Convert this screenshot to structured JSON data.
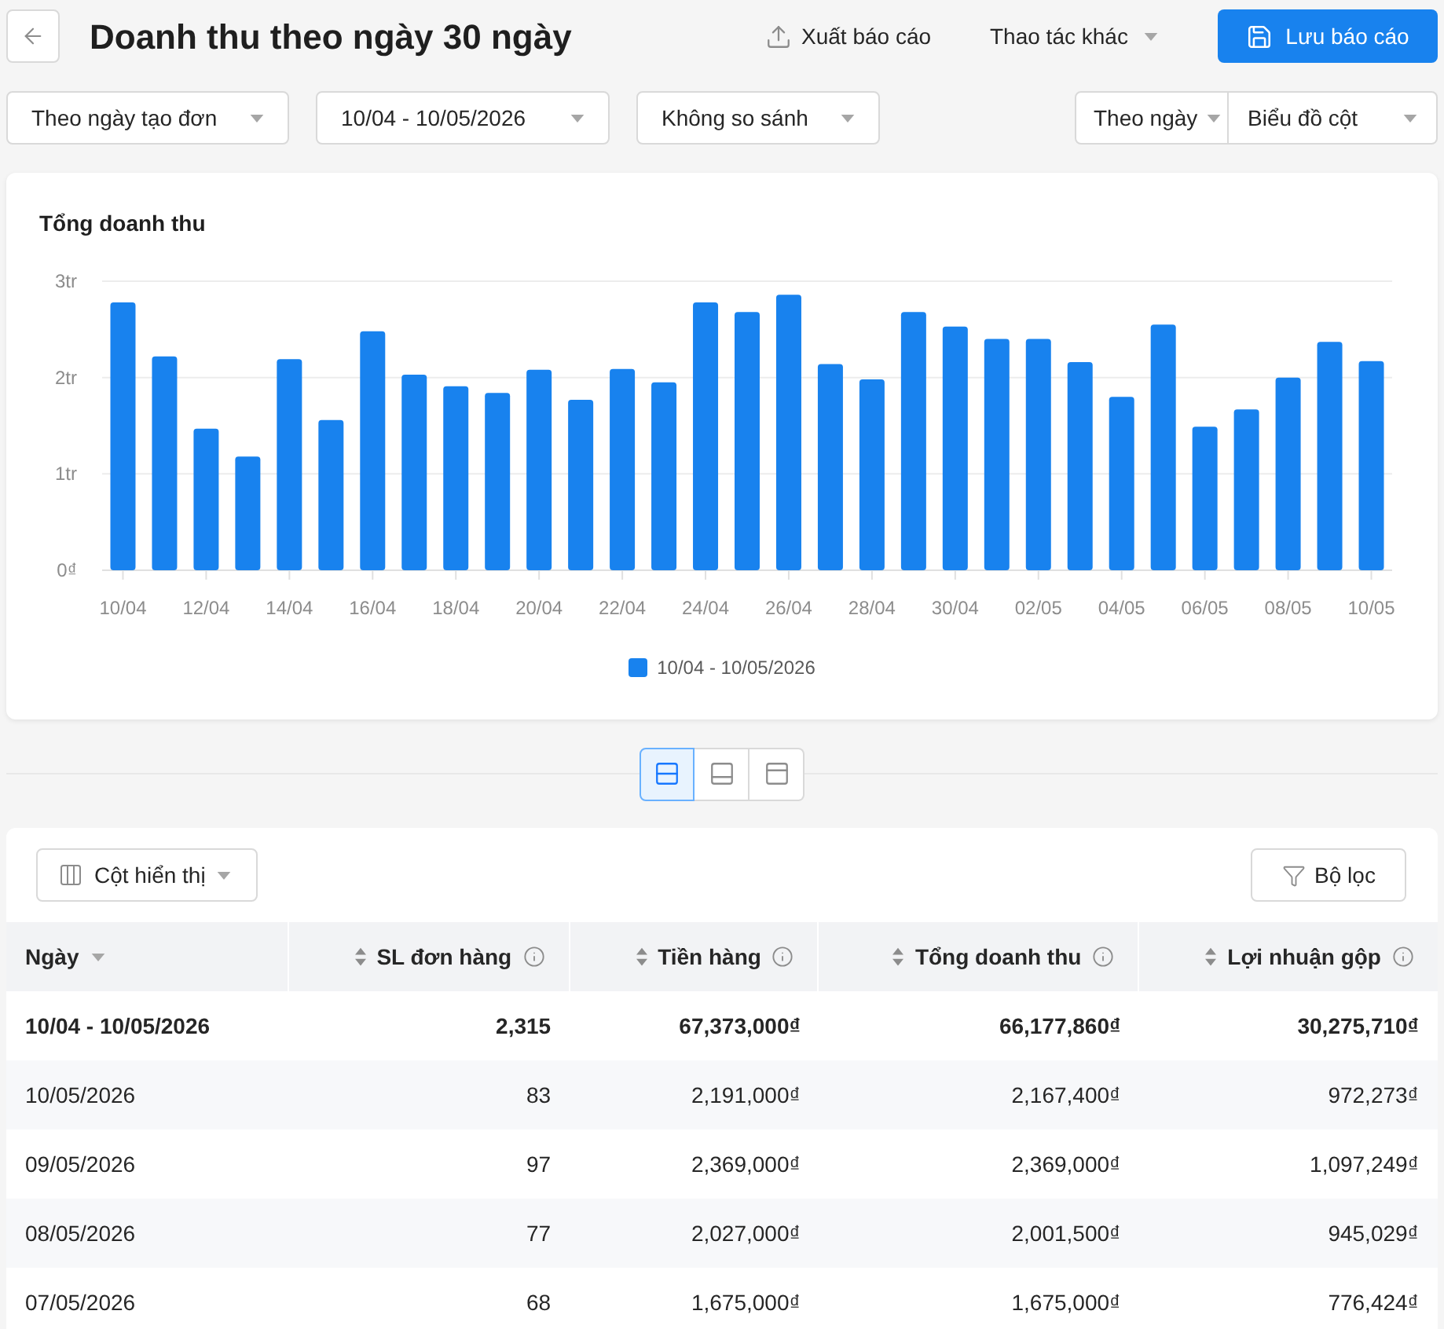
{
  "header": {
    "title": "Doanh thu theo ngày 30 ngày",
    "actions": [
      {
        "kind": "export",
        "label": "Xuất báo cáo"
      },
      {
        "kind": "menu",
        "label": "Thao tác khác"
      },
      {
        "kind": "save",
        "label": "Lưu báo cáo"
      }
    ]
  },
  "filters": [
    {
      "label": "Theo ngày tạo đơn"
    },
    {
      "label": "10/04 - 10/05/2026"
    },
    {
      "label": "Không so sánh"
    }
  ],
  "view_options": [
    {
      "label": "Theo ngày"
    },
    {
      "label": "Biểu đồ cột"
    }
  ],
  "chart_card": {
    "chart_data": {
      "type": "bar",
      "title": "Tổng doanh thu",
      "categories": [
        "10/04",
        null,
        "12/04",
        null,
        "14/04",
        null,
        "16/04",
        null,
        "18/04",
        null,
        "20/04",
        null,
        "22/04",
        null,
        "24/04",
        null,
        "26/04",
        null,
        "28/04",
        null,
        "30/04",
        null,
        "02/05",
        null,
        "04/05",
        null,
        "06/05",
        null,
        "08/05",
        null,
        "10/05"
      ],
      "series": [
        {
          "name": "10/04 - 10/05/2026",
          "color": "#1882ee",
          "values": [
            2.78,
            2.22,
            1.47,
            1.18,
            2.19,
            1.56,
            2.48,
            2.03,
            1.91,
            1.84,
            2.08,
            1.77,
            2.09,
            1.95,
            2.78,
            2.68,
            2.86,
            2.14,
            1.98,
            2.68,
            2.53,
            2.4,
            2.4,
            2.16,
            1.8,
            2.55,
            1.49,
            1.67,
            2.0,
            2.37,
            2.17
          ]
        }
      ],
      "ylim": [
        0,
        3
      ],
      "yticks": [
        {
          "value": 0,
          "label": "0₫"
        },
        {
          "value": 1,
          "label": "1tr"
        },
        {
          "value": 2,
          "label": "2tr"
        },
        {
          "value": 3,
          "label": "3tr"
        }
      ]
    }
  },
  "layout_toggle": [
    {
      "kind": "split",
      "selected": true
    },
    {
      "kind": "bottom",
      "selected": false
    },
    {
      "kind": "top",
      "selected": false
    }
  ],
  "table": {
    "toolbar": {
      "columns_button": "Cột hiển thị",
      "filter_button": "Bộ lọc"
    },
    "columns": [
      {
        "label": "Ngày",
        "kind": "dropdown"
      },
      {
        "label": "SL đơn hàng",
        "kind": "sortable"
      },
      {
        "label": "Tiền hàng",
        "kind": "sortable"
      },
      {
        "label": "Tổng doanh thu",
        "kind": "sortable"
      },
      {
        "label": "Lợi nhuận gộp",
        "kind": "sortable"
      }
    ],
    "rows": [
      {
        "kind": "total",
        "cells": [
          "10/04 - 10/05/2026",
          "2,315",
          "67,373,000₫",
          "66,177,860₫",
          "30,275,710₫"
        ]
      },
      {
        "kind": "day",
        "cells": [
          "10/05/2026",
          "83",
          "2,191,000₫",
          "2,167,400₫",
          "972,273₫"
        ]
      },
      {
        "kind": "day",
        "cells": [
          "09/05/2026",
          "97",
          "2,369,000₫",
          "2,369,000₫",
          "1,097,249₫"
        ]
      },
      {
        "kind": "day",
        "cells": [
          "08/05/2026",
          "77",
          "2,027,000₫",
          "2,001,500₫",
          "945,029₫"
        ]
      },
      {
        "kind": "day",
        "cells": [
          "07/05/2026",
          "68",
          "1,675,000₫",
          "1,675,000₫",
          "776,424₫"
        ]
      }
    ]
  }
}
